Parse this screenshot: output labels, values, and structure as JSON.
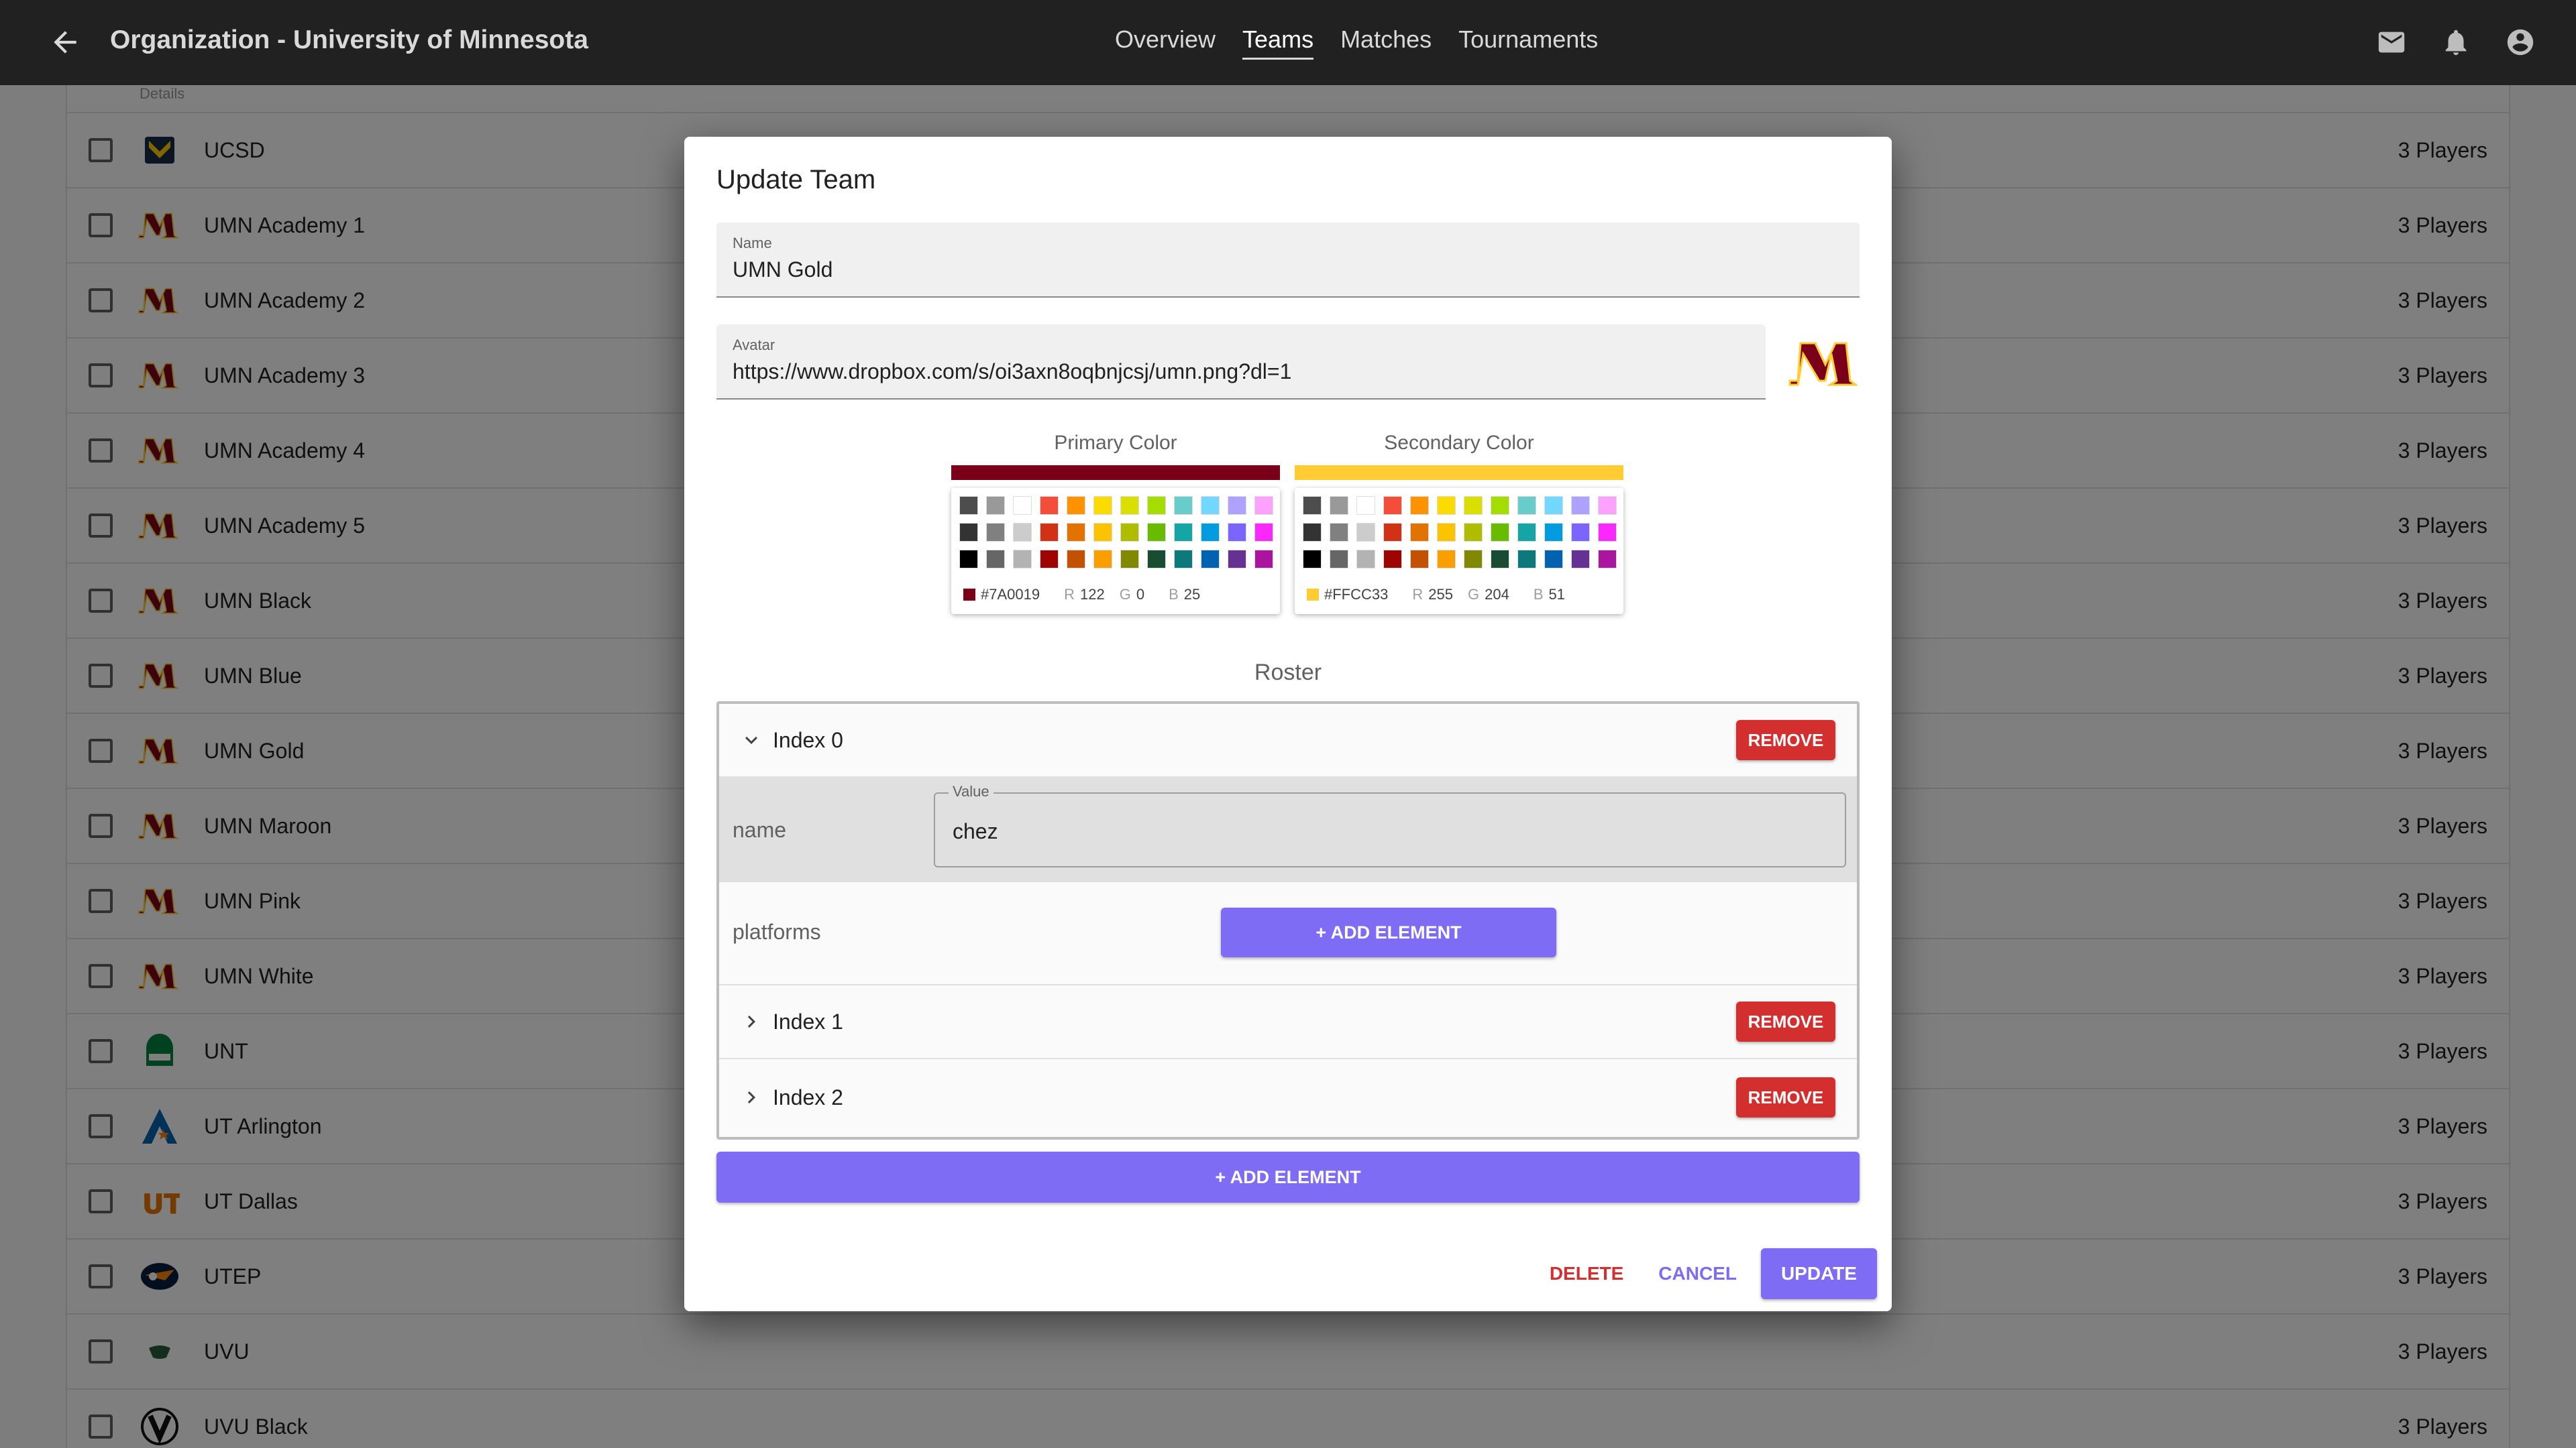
{
  "appbar": {
    "title": "Organization - University of Minnesota",
    "nav": [
      "Overview",
      "Teams",
      "Matches",
      "Tournaments"
    ],
    "active_tab": "Teams"
  },
  "list": {
    "partial_header": "Details",
    "rows": [
      {
        "name": "UCSD",
        "players": "3 Players",
        "logo": "ucsd"
      },
      {
        "name": "UMN Academy 1",
        "players": "3 Players",
        "logo": "umn"
      },
      {
        "name": "UMN Academy 2",
        "players": "3 Players",
        "logo": "umn"
      },
      {
        "name": "UMN Academy 3",
        "players": "3 Players",
        "logo": "umn"
      },
      {
        "name": "UMN Academy 4",
        "players": "3 Players",
        "logo": "umn"
      },
      {
        "name": "UMN Academy 5",
        "players": "3 Players",
        "logo": "umn"
      },
      {
        "name": "UMN Black",
        "players": "3 Players",
        "logo": "umn"
      },
      {
        "name": "UMN Blue",
        "players": "3 Players",
        "logo": "umn"
      },
      {
        "name": "UMN Gold",
        "players": "3 Players",
        "logo": "umn"
      },
      {
        "name": "UMN Maroon",
        "players": "3 Players",
        "logo": "umn"
      },
      {
        "name": "UMN Pink",
        "players": "3 Players",
        "logo": "umn"
      },
      {
        "name": "UMN White",
        "players": "3 Players",
        "logo": "umn"
      },
      {
        "name": "UNT",
        "players": "3 Players",
        "logo": "unt"
      },
      {
        "name": "UT Arlington",
        "players": "3 Players",
        "logo": "uta"
      },
      {
        "name": "UT Dallas",
        "players": "3 Players",
        "logo": "utd"
      },
      {
        "name": "UTEP",
        "players": "3 Players",
        "logo": "utep"
      },
      {
        "name": "UVU",
        "players": "3 Players",
        "logo": "uvu"
      },
      {
        "name": "UVU Black",
        "players": "3 Players",
        "logo": "uvu-black"
      }
    ]
  },
  "dialog": {
    "title": "Update Team",
    "name_label": "Name",
    "name_value": "UMN Gold",
    "avatar_label": "Avatar",
    "avatar_value": "https://www.dropbox.com/s/oi3axn8oqbnjcsj/umn.png?dl=1",
    "primary": {
      "label": "Primary Color",
      "hex": "#7A0019",
      "r_label": "R",
      "r": "122",
      "g_label": "G",
      "g": "0",
      "b_label": "B",
      "b": "25",
      "color": "#7A0019"
    },
    "secondary": {
      "label": "Secondary Color",
      "hex": "#FFCC33",
      "r_label": "R",
      "r": "255",
      "g_label": "G",
      "g": "204",
      "b_label": "B",
      "b": "51",
      "color": "#FFCC33"
    },
    "palette": [
      "#4d4d4d",
      "#999999",
      "#ffffff",
      "#f44e3b",
      "#fe9200",
      "#fcdc00",
      "#dbdf00",
      "#a4dd00",
      "#68ccca",
      "#73d8ff",
      "#aea1ff",
      "#fda1ff",
      "#333333",
      "#808080",
      "#cccccc",
      "#d33115",
      "#e27300",
      "#fcc400",
      "#b0bc00",
      "#68bc00",
      "#16a5a5",
      "#009ce0",
      "#7b64ff",
      "#fa28ff",
      "#000000",
      "#666666",
      "#b3b3b3",
      "#9f0500",
      "#c45100",
      "#fb9e00",
      "#808900",
      "#194d33",
      "#0c797d",
      "#0062b1",
      "#653294",
      "#ab149e"
    ],
    "roster_title": "Roster",
    "roster": [
      {
        "label": "Index 0",
        "expanded": true
      },
      {
        "label": "Index 1",
        "expanded": false
      },
      {
        "label": "Index 2",
        "expanded": false
      }
    ],
    "remove_label": "REMOVE",
    "field_name_key": "name",
    "value_label": "Value",
    "value_text": "chez",
    "platforms_key": "platforms",
    "add_element_label": "+ ADD ELEMENT",
    "delete_label": "DELETE",
    "cancel_label": "CANCEL",
    "update_label": "UPDATE"
  },
  "colors": {
    "accent": "#7e6cf5",
    "danger": "#d32f2f",
    "appbar": "#212121"
  }
}
